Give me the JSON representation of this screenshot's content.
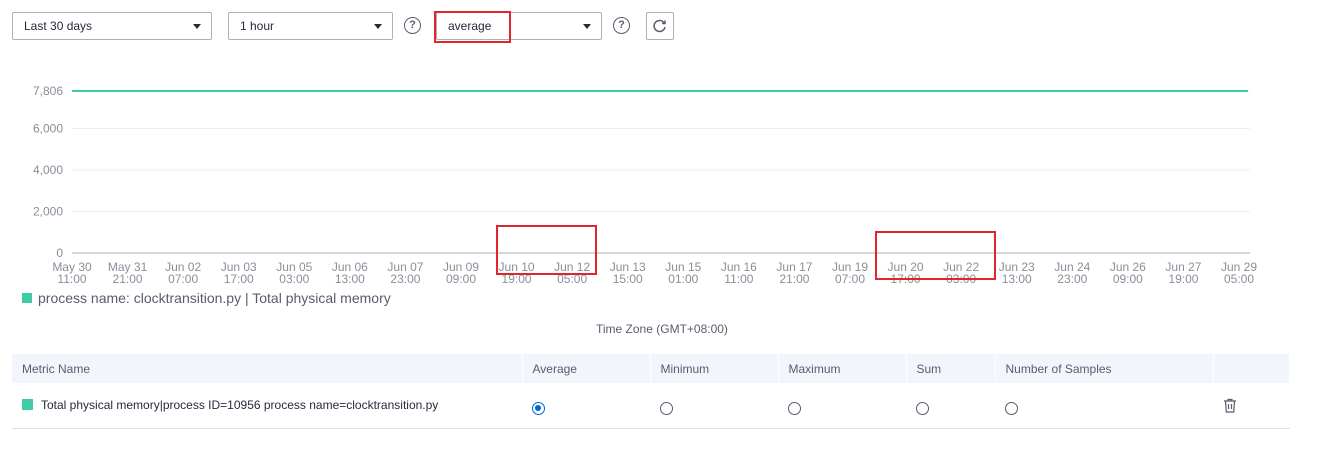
{
  "toolbar": {
    "period": "Last 30 days",
    "interval": "1 hour",
    "aggregation": "average"
  },
  "colors": {
    "series": "#3dcca6",
    "highlight": "#e0262c",
    "accent": "#0067d1"
  },
  "chart_data": {
    "type": "line",
    "y_ticks": [
      "7,806",
      "6,000",
      "4,000",
      "2,000",
      "0"
    ],
    "ylim": [
      0,
      7806
    ],
    "x_ticks": [
      [
        "May 30",
        "11:00"
      ],
      [
        "May 31",
        "21:00"
      ],
      [
        "Jun 02",
        "07:00"
      ],
      [
        "Jun 03",
        "17:00"
      ],
      [
        "Jun 05",
        "03:00"
      ],
      [
        "Jun 06",
        "13:00"
      ],
      [
        "Jun 07",
        "23:00"
      ],
      [
        "Jun 09",
        "09:00"
      ],
      [
        "Jun 10",
        "19:00"
      ],
      [
        "Jun 12",
        "05:00"
      ],
      [
        "Jun 13",
        "15:00"
      ],
      [
        "Jun 15",
        "01:00"
      ],
      [
        "Jun 16",
        "11:00"
      ],
      [
        "Jun 17",
        "21:00"
      ],
      [
        "Jun 19",
        "07:00"
      ],
      [
        "Jun 20",
        "17:00"
      ],
      [
        "Jun 22",
        "03:00"
      ],
      [
        "Jun 23",
        "13:00"
      ],
      [
        "Jun 24",
        "23:00"
      ],
      [
        "Jun 26",
        "09:00"
      ],
      [
        "Jun 27",
        "19:00"
      ],
      [
        "Jun 29",
        "05:00"
      ]
    ],
    "series": [
      {
        "name": "process name: clocktransition.py | Total physical memory",
        "values": [
          7806,
          7806
        ]
      }
    ]
  },
  "legend_label": "process name: clocktransition.py | Total physical memory",
  "timezone": "Time Zone  (GMT+08:00)",
  "table": {
    "headers": [
      "Metric Name",
      "Average",
      "Minimum",
      "Maximum",
      "Sum",
      "Number of Samples"
    ],
    "rows": [
      {
        "metric": "Total physical memory|process ID=10956 process name=clocktransition.py"
      }
    ]
  }
}
